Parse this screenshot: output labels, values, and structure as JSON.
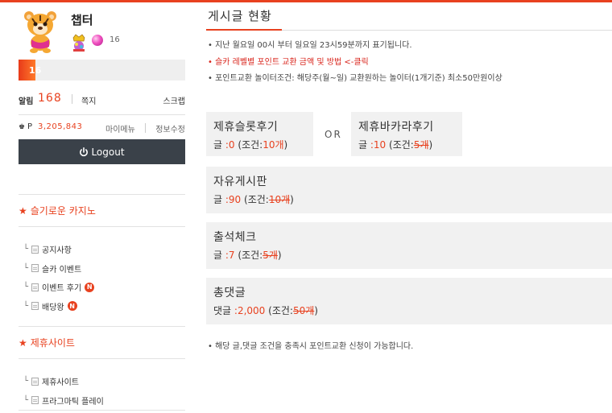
{
  "profile": {
    "nickname": "챕터",
    "level": "16",
    "level_progress": 0.1
  },
  "alarm": {
    "label": "알림",
    "count": "168"
  },
  "menu_links": {
    "memo": "쪽지",
    "scrap": "스크랩",
    "mypage": "마이메뉴",
    "info_edit": "정보수정"
  },
  "points": {
    "label": "P",
    "value": "3,205,843"
  },
  "logout": {
    "label": "Logout"
  },
  "section1": {
    "title": "슬기로운 카지노",
    "items": [
      {
        "label": "공지사항",
        "new": false
      },
      {
        "label": "슬카 이벤트",
        "new": false
      },
      {
        "label": "이벤트 후기",
        "new": true
      },
      {
        "label": "배당왕",
        "new": true
      }
    ]
  },
  "section2": {
    "title": "제휴사이트",
    "items": [
      {
        "label": "제휴사이트"
      },
      {
        "label": "프라그마틱 플레이"
      }
    ]
  },
  "new_badge": "N",
  "main": {
    "title": "게시글 현황",
    "notices": [
      "• 지난 월요일 00시 부터 일요일 23시59분까지 표기됩니다.",
      "• 슬카 레벨별 포인트 교환 금액 및 방법 <-클릭",
      "• 포인트교환 놀이터조건: 해당주(월~일) 교환원하는 놀이터(1개기준) 최소50만원이상"
    ],
    "or_label": "OR",
    "footnote": "• 해당 글,댓글 조건을 충족시 포인트교환 신청이 가능합니다."
  },
  "cards": {
    "slot": {
      "title": "제휴슬롯후기",
      "prefix": "글",
      "value": ":0",
      "cond_prefix": "(조건:",
      "cond": "10개",
      "suffix": ")"
    },
    "baccarat": {
      "title": "제휴바카라후기",
      "prefix": "글",
      "value": ":10",
      "cond_prefix": "(조건:",
      "cond": "5개",
      "suffix": ")"
    },
    "free": {
      "title": "자유게시판",
      "prefix": "글",
      "value": ":90",
      "cond_prefix": "(조건:",
      "cond": "10개",
      "suffix": ")"
    },
    "attendance": {
      "title": "출석체크",
      "prefix": "글",
      "value": ":7",
      "cond_prefix": "(조건:",
      "cond": "5개",
      "suffix": ")"
    },
    "comments": {
      "title": "총댓글",
      "prefix": "댓글",
      "value": ":2,000",
      "cond_prefix": "(조건:",
      "cond": "50개",
      "suffix": ")"
    }
  },
  "colors": {
    "accent": "#e8411f",
    "dark_button": "#3a4149",
    "card_bg": "#f1f1f1"
  }
}
